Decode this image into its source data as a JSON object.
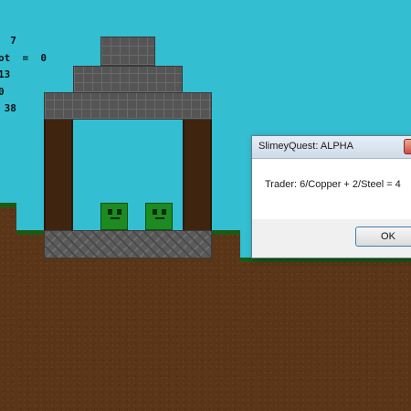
{
  "hud": {
    "lines": [
      "  7",
      "ot  =  0",
      "13",
      "0",
      " 38"
    ]
  },
  "dialog": {
    "title": "SlimeyQuest: ALPHA",
    "message": "Trader: 6/Copper + 2/Steel = 4",
    "ok_label": "OK",
    "close_glyph": "×"
  },
  "colors": {
    "sky": "#33bfd1",
    "grass": "#1c5a14",
    "dirt": "#5a3518",
    "stone": "#555555",
    "wood": "#3f2410",
    "slime": "#1d8a22"
  }
}
